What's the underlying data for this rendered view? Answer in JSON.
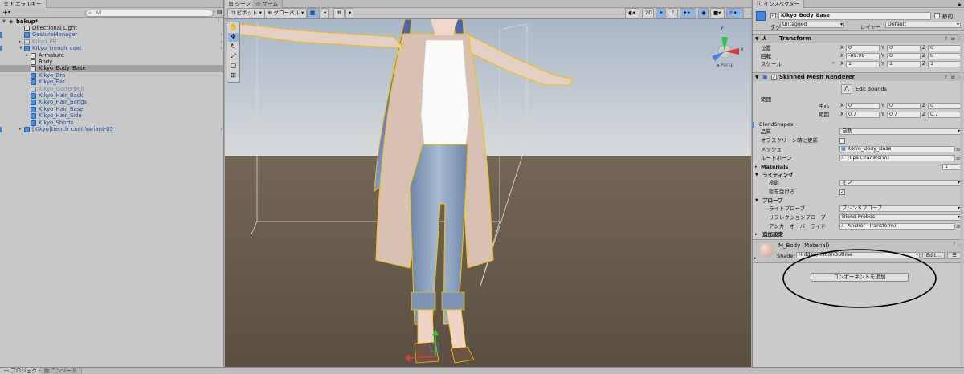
{
  "hierarchy": {
    "tab": "ヒエラルキー",
    "add": "+",
    "add_arrow": "▾",
    "search_placeholder": "All",
    "scene_name": "bakup*",
    "items": [
      {
        "label": "Directional Light",
        "type": "object"
      },
      {
        "label": "GestureManager",
        "type": "blue"
      },
      {
        "label": "Kikyo_PB",
        "type": "disabled"
      },
      {
        "label": "Kikyo_trench_coat",
        "type": "prefab"
      },
      {
        "label": "Armature",
        "type": "object"
      },
      {
        "label": "Body",
        "type": "object"
      },
      {
        "label": "Kikyo_Body_Base",
        "type": "object",
        "selected": true
      },
      {
        "label": "Kikyo_Bra",
        "type": "prefab"
      },
      {
        "label": "Kikyo_Ear",
        "type": "prefab"
      },
      {
        "label": "Kikyo_GarterBelt",
        "type": "disabled"
      },
      {
        "label": "Kikyo_Hair_Back",
        "type": "prefab"
      },
      {
        "label": "Kikyo_Hair_Bangs",
        "type": "prefab"
      },
      {
        "label": "Kikyo_Hair_Base",
        "type": "prefab"
      },
      {
        "label": "Kikyo_Hair_Side",
        "type": "prefab"
      },
      {
        "label": "Kikyo_Shorts",
        "type": "prefab"
      },
      {
        "label": "[Kikyo]trench_coat Variant-05",
        "type": "prefab"
      }
    ]
  },
  "scene": {
    "tabs": [
      "シーン",
      "ゲーム"
    ],
    "toolbar": {
      "pivot": "ピボット",
      "global": "グローバル",
      "mode_2d": "2D"
    },
    "gizmo": {
      "persp": "Persp",
      "x": "x",
      "y": "y"
    }
  },
  "inspector": {
    "tab": "インスペクター",
    "object_name": "Kikyo_Body_Base",
    "static_label": "静的",
    "tag_label": "タグ",
    "tag_value": "Untagged",
    "layer_label": "レイヤー",
    "layer_value": "Default",
    "transform": {
      "title": "Transform",
      "rows": [
        {
          "label": "位置",
          "x": "0",
          "y": "0",
          "z": "0"
        },
        {
          "label": "回転",
          "x": "-89.98",
          "y": "0",
          "z": "0"
        },
        {
          "label": "スケール",
          "x": "1",
          "y": "1",
          "z": "1"
        }
      ]
    },
    "axes": {
      "x": "X",
      "y": "Y",
      "z": "Z"
    },
    "smr": {
      "title": "Skinned Mesh Renderer",
      "edit_bounds": "Edit Bounds",
      "bounds_label": "範囲",
      "center_label": "中心",
      "extent_label": "範囲",
      "center": {
        "x": "0",
        "y": "0",
        "z": "0"
      },
      "extent": {
        "x": "0.7",
        "y": "0.7",
        "z": "0.7"
      },
      "blendshapes": "BlendShapes",
      "quality_label": "品質",
      "quality_value": "自動",
      "offscreen_label": "オフスクリーン時に更新",
      "mesh_label": "メッシュ",
      "mesh_value": "Kikyo_Body_Base",
      "rootbone_label": "ルートボーン",
      "rootbone_value": "Hips (Transform)",
      "materials_label": "Materials",
      "materials_count": "1",
      "lighting_label": "ライティング",
      "cast_label": "投影",
      "cast_value": "オン",
      "receive_label": "影を受ける",
      "probes_label": "プローブ",
      "lightprobe_label": "ライトプローブ",
      "lightprobe_value": "ブレンドプローブ",
      "reflprobe_label": "リフレクションプローブ",
      "reflprobe_value": "Blend Probes",
      "anchor_label": "アンカーオーバーライド",
      "anchor_value": "Anchor (Transform)",
      "additional_label": "追加設定"
    },
    "material": {
      "name": "M_Body (Material)",
      "shader_label": "Shader",
      "shader_value": "Hidden/lilToonOutline",
      "edit_label": "Edit...",
      "menu": "☰"
    },
    "add_component": "コンポーネントを追加",
    "icons": [
      "help-icon",
      "preset-icon",
      "menu-icon"
    ]
  },
  "bottom": {
    "tabs": [
      "プロジェクト",
      "コンソール"
    ]
  },
  "colors": {
    "selection_outline": "#f2c200",
    "panel": "#c8c8c8",
    "accent": "#4a8ee0"
  }
}
